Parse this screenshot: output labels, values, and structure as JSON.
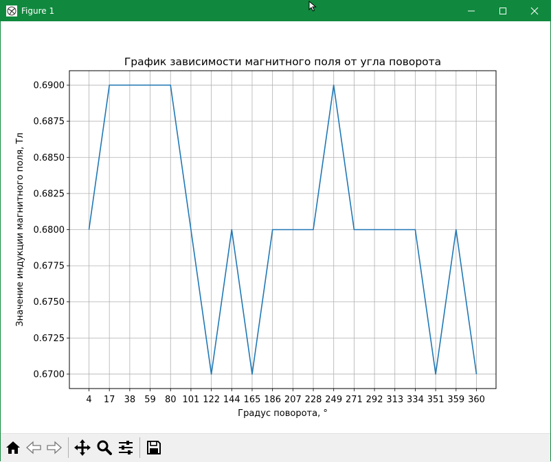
{
  "window": {
    "title": "Figure 1",
    "accent_color": "#10893e",
    "controls": [
      "minimize-icon",
      "maximize-icon",
      "close-icon"
    ]
  },
  "toolbar": {
    "buttons": [
      {
        "name": "home-button",
        "icon": "home-icon"
      },
      {
        "name": "back-button",
        "icon": "arrow-left-icon"
      },
      {
        "name": "forward-button",
        "icon": "arrow-right-icon"
      },
      {
        "name": "pan-button",
        "icon": "move-icon"
      },
      {
        "name": "zoom-button",
        "icon": "magnifier-icon"
      },
      {
        "name": "configure-subplots-button",
        "icon": "sliders-icon"
      },
      {
        "name": "save-button",
        "icon": "floppy-disk-icon"
      }
    ]
  },
  "chart_data": {
    "type": "line",
    "title": "График зависимости магнитного поля от угла поворота",
    "xlabel": "Градус поворота, °",
    "ylabel": "Значение индукции магнитного поля, Тл",
    "x_scale": "categorical",
    "categories": [
      "4",
      "17",
      "38",
      "59",
      "80",
      "101",
      "122",
      "144",
      "165",
      "186",
      "207",
      "228",
      "249",
      "271",
      "292",
      "313",
      "334",
      "351",
      "359",
      "360"
    ],
    "series": [
      {
        "color": "#1f77b4",
        "values": [
          0.68,
          0.69,
          0.69,
          0.69,
          0.69,
          0.68,
          0.67,
          0.68,
          0.67,
          0.68,
          0.68,
          0.68,
          0.69,
          0.68,
          0.68,
          0.68,
          0.68,
          0.67,
          0.68,
          0.67
        ]
      }
    ],
    "ylim": [
      0.669,
      0.691
    ],
    "yticks": [
      "0.6700",
      "0.6725",
      "0.6750",
      "0.6775",
      "0.6800",
      "0.6825",
      "0.6850",
      "0.6875",
      "0.6900"
    ],
    "ytick_values": [
      0.67,
      0.6725,
      0.675,
      0.6775,
      0.68,
      0.6825,
      0.685,
      0.6875,
      0.69
    ],
    "grid": true,
    "legend": "none"
  }
}
